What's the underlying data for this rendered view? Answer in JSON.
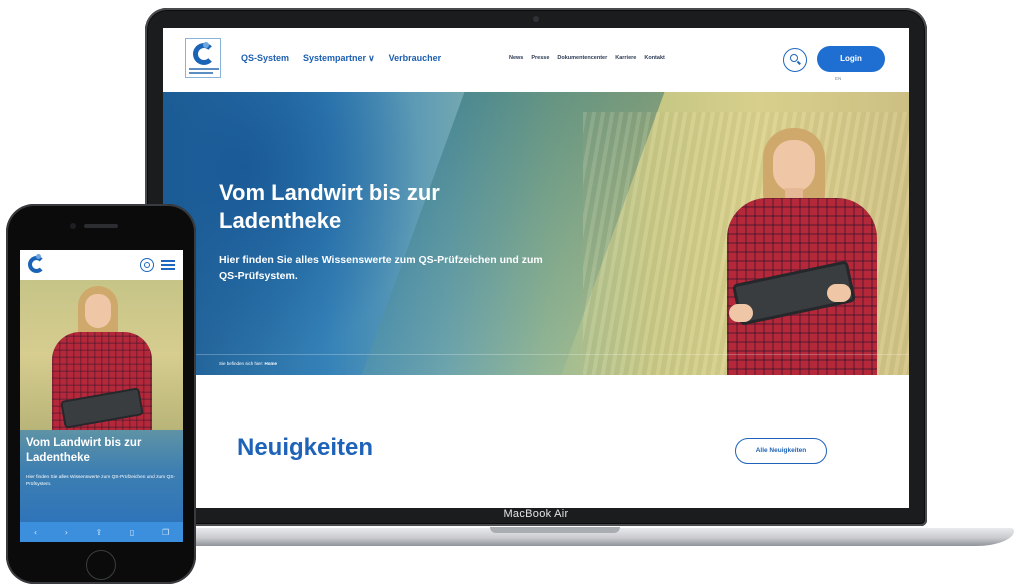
{
  "laptop": {
    "device_label": "MacBook Air",
    "header": {
      "main_nav": [
        "QS-System",
        "Systempartner",
        "Verbraucher"
      ],
      "meta_nav": [
        "News",
        "Presse",
        "Dokumentencenter",
        "Karriere",
        "Kontakt"
      ],
      "login_label": "Login",
      "language": "EN",
      "search_icon": "search-icon"
    },
    "hero": {
      "title": "Vom Landwirt bis zur Ladentheke",
      "subtitle": "Hier finden Sie alles Wissenswerte zum QS-Prüfzeichen und zum QS-Prüfsystem.",
      "breadcrumb_prefix": "Sie befinden sich hier:",
      "breadcrumb_current": "Home"
    },
    "news": {
      "title": "Neuigkeiten",
      "all_news_label": "Alle Neuigkeiten"
    }
  },
  "phone": {
    "hero": {
      "title": "Vom Landwirt bis zur Ladentheke",
      "subtitle": "Hier finden Sie alles Wissenswerte zum QS-Prüfzeichen und zum QS-Prüfsystem."
    },
    "toolbar": {
      "back": "‹",
      "forward": "›",
      "share": "⇪",
      "bookmarks": "▯",
      "tabs": "❐"
    }
  },
  "colors": {
    "brand_blue": "#1e63b8",
    "login_blue": "#1f6fd2"
  }
}
